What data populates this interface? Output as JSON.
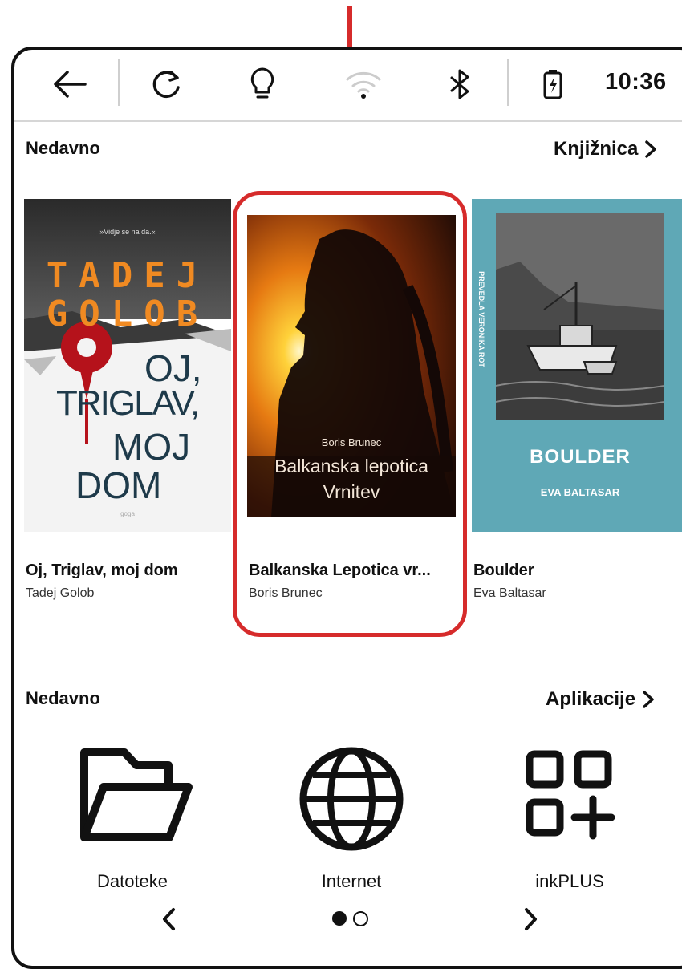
{
  "status_bar": {
    "time": "10:36",
    "icons": [
      "back-arrow-icon",
      "refresh-icon",
      "frontlight-bulb-icon",
      "wifi-icon",
      "bluetooth-icon",
      "battery-icon"
    ]
  },
  "recent_books": {
    "title": "Nedavno",
    "link_label": "Knjižnica",
    "books": [
      {
        "title": "Oj, Triglav, moj dom",
        "author": "Tadej Golob",
        "cover": {
          "tagline": "»Vidje se na da.«",
          "author_line1": "TADEJ",
          "author_line2": "GOLOB",
          "title_lines": [
            "OJ,",
            "TRIGLAV,",
            "MOJ",
            "DOM"
          ],
          "publisher": "goga"
        }
      },
      {
        "title": "Balkanska Lepotica vr...",
        "author": "Boris Brunec",
        "cover": {
          "author": "Boris Brunec",
          "title_line1": "Balkanska lepotica",
          "title_line2": "Vrnitev"
        }
      },
      {
        "title": "Boulder",
        "author": "Eva Baltasar",
        "cover": {
          "title": "BOULDER",
          "author": "EVA BALTASAR",
          "translator": "PREVEDLA VERONIKA ROT"
        }
      }
    ]
  },
  "recent_apps": {
    "title": "Nedavno",
    "link_label": "Aplikacije",
    "apps": [
      {
        "label": "Datoteke",
        "icon": "folder-icon"
      },
      {
        "label": "Internet",
        "icon": "globe-icon"
      },
      {
        "label": "inkPLUS",
        "icon": "apps-grid-plus-icon"
      }
    ]
  },
  "pagination": {
    "current_page": 1,
    "total_pages": 2
  },
  "colors": {
    "highlight": "#d62b2b",
    "boulder_cover": "#5fa8b6",
    "golob_orange": "#f08a22"
  }
}
